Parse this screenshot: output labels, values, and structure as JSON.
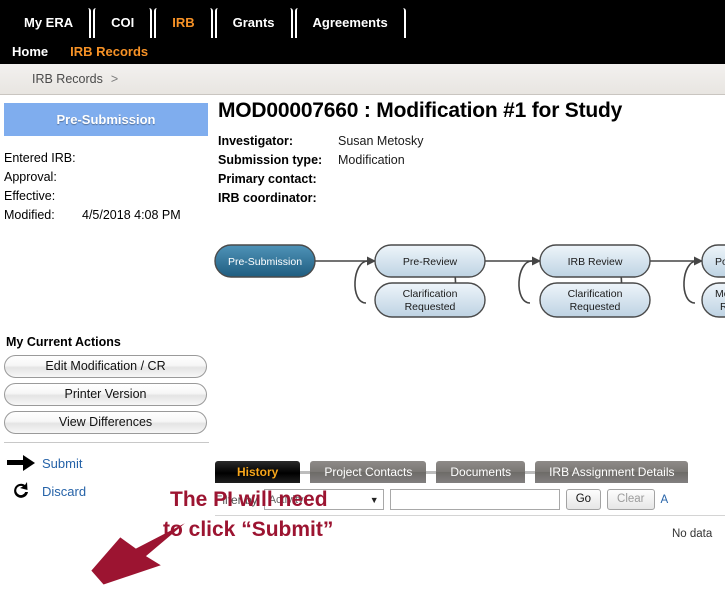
{
  "topnav": {
    "tabs": [
      {
        "label": "My ERA",
        "active": false
      },
      {
        "label": "COI",
        "active": false
      },
      {
        "label": "IRB",
        "active": true
      },
      {
        "label": "Grants",
        "active": false
      },
      {
        "label": "Agreements",
        "active": false
      }
    ],
    "subnav": [
      {
        "label": "Home",
        "active": false
      },
      {
        "label": "IRB Records",
        "active": true
      }
    ],
    "active_color": "#f79226"
  },
  "breadcrumb": {
    "items": [
      "IRB Records"
    ],
    "separator": ">"
  },
  "status": {
    "badge": "Pre-Submission",
    "badge_color": "#7fadee"
  },
  "dates": {
    "rows": [
      {
        "key": "Entered IRB:",
        "value": ""
      },
      {
        "key": "Approval:",
        "value": ""
      },
      {
        "key": "Effective:",
        "value": ""
      },
      {
        "key": "Modified:",
        "value": "4/5/2018 4:08 PM"
      }
    ]
  },
  "header": {
    "title": "MOD00007660 :  Modification #1 for Study",
    "info": [
      {
        "key": "Investigator:",
        "value": "Susan Metosky"
      },
      {
        "key": "Submission type:",
        "value": "Modification"
      },
      {
        "key": "Primary contact:",
        "value": ""
      },
      {
        "key": "IRB coordinator:",
        "value": ""
      }
    ]
  },
  "workflow": {
    "nodes": [
      {
        "label": "Pre-Submission",
        "state": "current"
      },
      {
        "label": "Pre-Review",
        "state": "upcoming"
      },
      {
        "label": "Clarification Requested",
        "state": "upcoming"
      },
      {
        "label": "IRB Review",
        "state": "upcoming"
      },
      {
        "label": "Clarification Requested",
        "state": "upcoming"
      },
      {
        "label": "Post-R",
        "state": "upcoming"
      },
      {
        "label": "Modific Requ",
        "state": "upcoming"
      }
    ],
    "current_fill": "#2e7195",
    "upcoming_fill": "#cfdfea"
  },
  "actions": {
    "heading": "My Current Actions",
    "buttons": [
      {
        "label": "Edit Modification / CR"
      },
      {
        "label": "Printer Version"
      },
      {
        "label": "View Differences"
      }
    ],
    "links": [
      {
        "label": "Submit",
        "icon": "arrow-right-icon"
      },
      {
        "label": "Discard",
        "icon": "undo-circle-icon"
      }
    ]
  },
  "content": {
    "tabs": [
      {
        "label": "History",
        "active": true
      },
      {
        "label": "Project Contacts",
        "active": false
      },
      {
        "label": "Documents",
        "active": false
      },
      {
        "label": "IRB Assignment Details",
        "active": false
      }
    ],
    "filter": {
      "label": "Filter by",
      "select_value": "Activity",
      "text_value": "",
      "go_label": "Go",
      "clear_label": "Clear",
      "more_label": "A"
    },
    "empty_message": "No data"
  },
  "annotation": {
    "line1": "The PI will need",
    "line2": "to click “Submit”",
    "color": "#9c1431"
  }
}
